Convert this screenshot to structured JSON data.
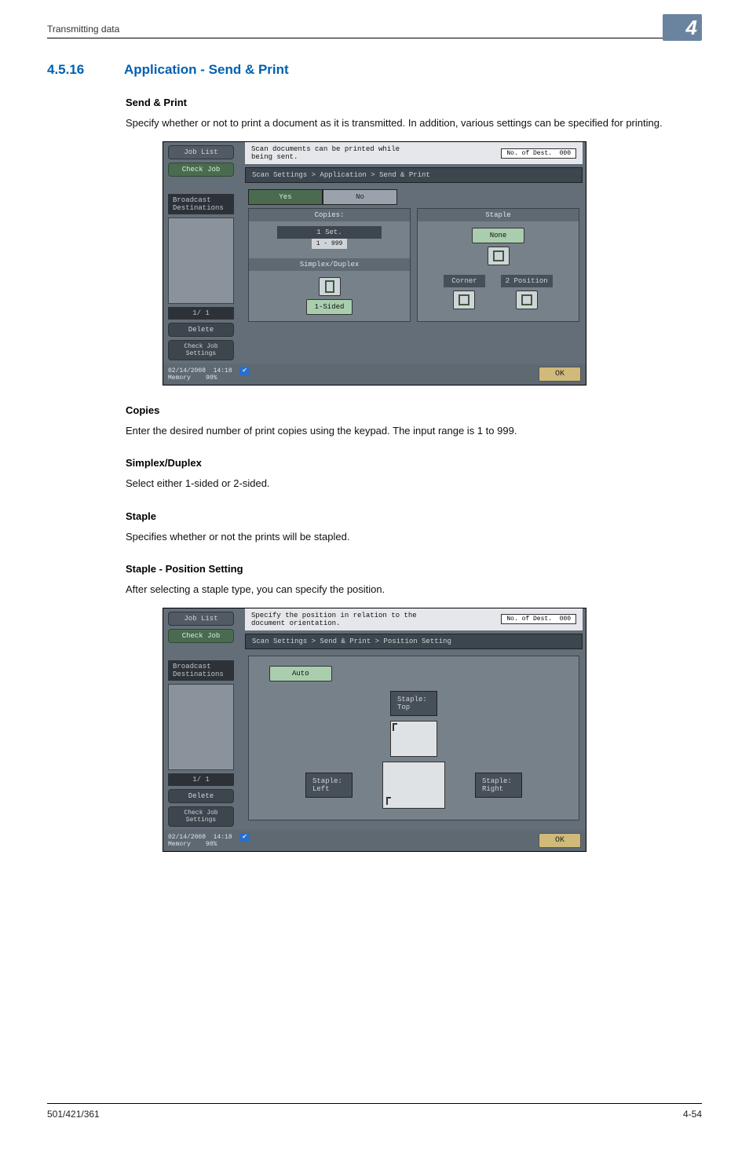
{
  "running_head": "Transmitting data",
  "chapter_badge": "4",
  "section": {
    "number": "4.5.16",
    "title": "Application - Send & Print"
  },
  "sub_send_print": {
    "head": "Send & Print",
    "body": "Specify whether or not to print a document as it is transmitted. In addition, various settings can be specified for printing."
  },
  "shot1": {
    "msg_line1": "Scan documents can be printed while",
    "msg_line2": "being sent.",
    "dest_label": "No. of Dest.",
    "dest_value": "000",
    "job_list": "Job List",
    "check_job": "Check Job",
    "broadcast": "Broadcast Destinations",
    "page_ind": "1/   1",
    "delete": "Delete",
    "check_settings": "Check Job Settings",
    "crumb": "Scan Settings > Application > Send & Print",
    "yes": "Yes",
    "no": "No",
    "copies_head": "Copies:",
    "copies_val": "1 Set.",
    "copies_range": "1   -   999",
    "simplex_head": "Simplex/Duplex",
    "simplex_val": "1-Sided",
    "staple_head": "Staple",
    "staple_none": "None",
    "staple_corner": "Corner",
    "staple_2pos": "2 Position",
    "date": "02/14/2008",
    "time": "14:18",
    "memory": "Memory",
    "mem_pct": "90%",
    "ok": "OK"
  },
  "sub_copies": {
    "head": "Copies",
    "body": "Enter the desired number of print copies using the keypad. The input range is 1 to 999."
  },
  "sub_simplex": {
    "head": "Simplex/Duplex",
    "body": "Select either 1-sided or 2-sided."
  },
  "sub_staple": {
    "head": "Staple",
    "body": "Specifies whether or not the prints will be stapled."
  },
  "sub_staple_pos": {
    "head": "Staple - Position Setting",
    "body": "After selecting a staple type, you can specify the position."
  },
  "shot2": {
    "msg_line1": "Specify the position in relation to the",
    "msg_line2": "document orientation.",
    "dest_label": "No. of Dest.",
    "dest_value": "000",
    "job_list": "Job List",
    "check_job": "Check Job",
    "broadcast": "Broadcast Destinations",
    "page_ind": "1/   1",
    "delete": "Delete",
    "check_settings": "Check Job Settings",
    "crumb": "Scan Settings > Send & Print > Position Setting",
    "auto": "Auto",
    "pos_top": "Staple: Top",
    "pos_left": "Staple: Left",
    "pos_right": "Staple: Right",
    "date": "02/14/2008",
    "time": "14:18",
    "memory": "Memory",
    "mem_pct": "90%",
    "ok": "OK"
  },
  "footer": {
    "left": "501/421/361",
    "right": "4-54"
  }
}
